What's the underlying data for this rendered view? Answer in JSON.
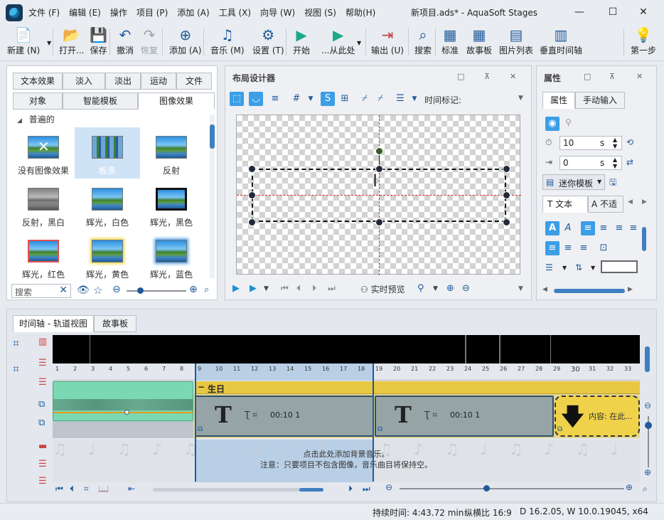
{
  "window": {
    "title": "新项目.ads* - AquaSoft Stages",
    "menu": [
      "文件 (F)",
      "编辑 (E)",
      "操作",
      "项目 (P)",
      "添加 (A)",
      "工具 (X)",
      "向导 (W)",
      "视图 (S)",
      "帮助(H)"
    ],
    "controls": {
      "minimize": "—",
      "maximize": "☐",
      "close": "✕"
    }
  },
  "toolbar": {
    "buttons": [
      {
        "label": "新建 (N)",
        "icon": "📄"
      },
      {
        "label": "打开...",
        "icon": "📂"
      },
      {
        "label": "保存",
        "icon": "💾"
      },
      {
        "label": "撤消",
        "icon": "↶"
      },
      {
        "label": "恢复",
        "icon": "↷"
      },
      {
        "label": "添加 (A)",
        "icon": "⊕"
      },
      {
        "label": "音乐 (M)",
        "icon": "♫"
      },
      {
        "label": "设置 (T)",
        "icon": "⚙"
      },
      {
        "label": "开始",
        "icon": "▶"
      },
      {
        "label": "...从此处",
        "icon": "▶"
      },
      {
        "label": "输出 (U)",
        "icon": "⇥"
      },
      {
        "label": "搜索",
        "icon": "⌕"
      },
      {
        "label": "标准",
        "icon": "▦"
      },
      {
        "label": "故事板",
        "icon": "▦"
      },
      {
        "label": "图片列表",
        "icon": "▤"
      },
      {
        "label": "垂直时间轴",
        "icon": "▥"
      },
      {
        "label": "第一步",
        "icon": "💡"
      }
    ]
  },
  "effects_panel": {
    "tabs_row1": [
      "文本效果",
      "淡入",
      "淡出",
      "运动",
      "文件"
    ],
    "tabs_row2": [
      "对象",
      "智能模板",
      "图像效果"
    ],
    "active_tab": "图像效果",
    "group_label": "普遍的",
    "items": [
      "没有图像效果",
      "板条",
      "反射",
      "反射，黑白",
      "辉光，白色",
      "辉光，黑色",
      "辉光，红色",
      "辉光，黄色",
      "辉光，蓝色"
    ],
    "selected_item": "板条",
    "search_placeholder": "搜索"
  },
  "layout_designer": {
    "title": "布局设计器",
    "time_marker_label": "时间标记:",
    "realtime_preview": "实时预览"
  },
  "properties_panel": {
    "title": "属性",
    "tabs": [
      "属性",
      "手动输入"
    ],
    "duration_value": "10",
    "duration_unit": "s",
    "offset_value": "0",
    "offset_unit": "s",
    "mini_template": "迷你模板",
    "text_tabs": [
      "文本",
      "不适"
    ]
  },
  "timeline": {
    "tabs": [
      "时间轴 - 轨道视图",
      "故事板"
    ],
    "active_tab": "时间轴 - 轨道视图",
    "ruler": [
      1,
      2,
      3,
      4,
      5,
      6,
      7,
      8,
      9,
      10,
      11,
      12,
      13,
      14,
      15,
      16,
      17,
      18,
      19,
      20,
      21,
      22,
      23,
      24,
      25,
      26,
      27,
      28,
      29,
      30,
      31,
      32,
      33
    ],
    "chapter_label": "生日",
    "clips": [
      {
        "type": "text",
        "glyph": "T",
        "time": "00:10 1"
      },
      {
        "type": "text",
        "glyph": "T",
        "time": "00:10 1"
      },
      {
        "type": "placeholder",
        "label": "内容: 在此..."
      }
    ],
    "music_hint_line1": "点击此处添加背景音乐。",
    "music_hint_line2": "注意：只要项目不包含图像，音乐曲目将保持空。"
  },
  "status_bar": {
    "duration": "持续时间: 4:43.72 min",
    "aspect": "纵横比 16:9",
    "version": "D 16.2.05, W 10.0.19045, x64"
  }
}
